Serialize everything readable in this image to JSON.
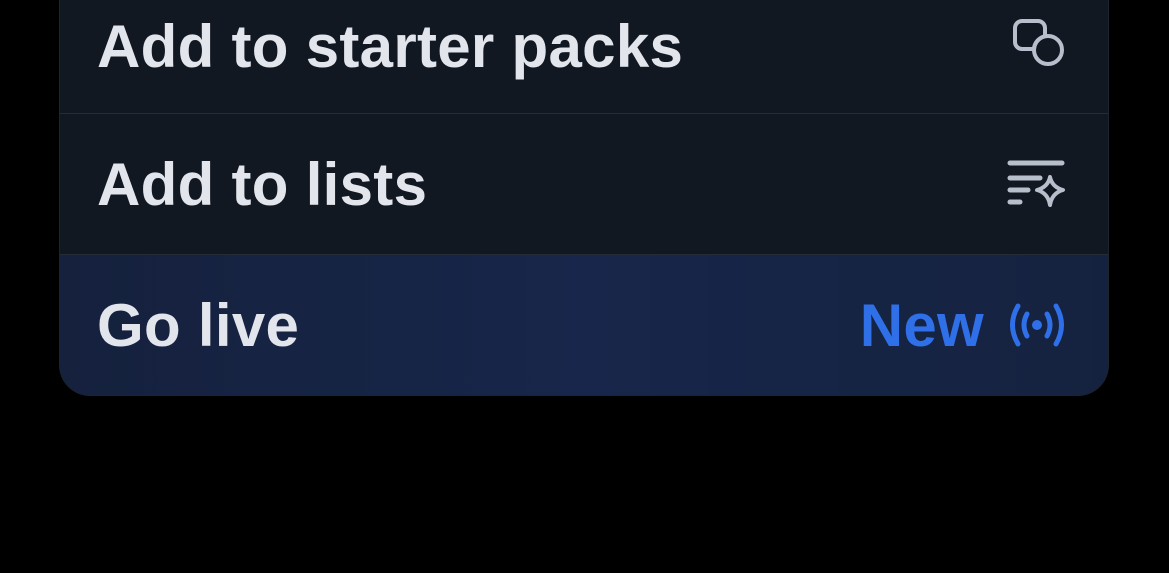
{
  "menu": {
    "items": [
      {
        "label": "Add to starter packs",
        "icon": "starter-pack-icon"
      },
      {
        "label": "Add to lists",
        "icon": "list-sparkle-icon"
      },
      {
        "label": "Go live",
        "icon": "broadcast-icon",
        "badge": "New"
      }
    ]
  },
  "colors": {
    "background": "#000000",
    "menu_bg": "#121821",
    "highlight_bg": "#17264a",
    "text": "#e2e5ec",
    "icon": "#b8bfcc",
    "accent": "#2f6fe8"
  }
}
